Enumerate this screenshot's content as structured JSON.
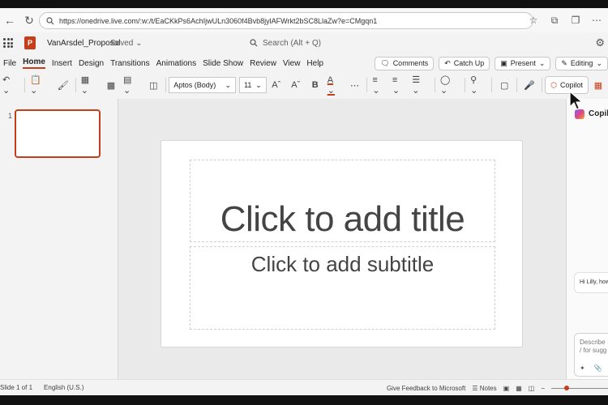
{
  "browser": {
    "url": "https://onedrive.live.com/:w:/t/EaCKkPs6AchIjwULn3060f4Bvb8jylAFWrkt2bSC8LlaZw?e=CMgqn1",
    "back_icon": "back-arrow-icon",
    "refresh_icon": "refresh-icon"
  },
  "app": {
    "doc_name": "VanArsdel_Proposal",
    "doc_status": "Saved",
    "search_placeholder": "Search (Alt + Q)",
    "brand_color": "#c43e1c"
  },
  "tabs": [
    "File",
    "Home",
    "Insert",
    "Design",
    "Transitions",
    "Animations",
    "Slide Show",
    "Review",
    "View",
    "Help"
  ],
  "active_tab": "Home",
  "ribbon_right": {
    "comments": "Comments",
    "catch_up": "Catch Up",
    "present": "Present",
    "editing": "Editing"
  },
  "toolbar": {
    "font_name": "Aptos (Body)",
    "font_size": "11",
    "copilot": "Copilot"
  },
  "thumbnails": [
    {
      "number": "1"
    }
  ],
  "slide": {
    "title_placeholder": "Click to add title",
    "subtitle_placeholder": "Click to add subtitle"
  },
  "copilot_pane": {
    "title": "Copilot",
    "greeting": "Hi Lilly, how",
    "input_line1": "Describe",
    "input_line2": "/ for sugg"
  },
  "statusbar": {
    "slide_count": "Slide 1 of 1",
    "language": "English (U.S.)",
    "feedback": "Give Feedback to Microsoft",
    "notes": "Notes"
  }
}
